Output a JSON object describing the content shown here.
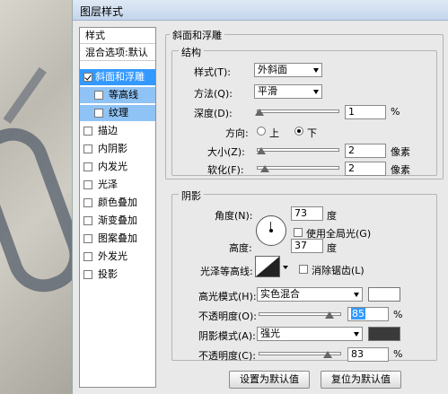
{
  "window_title": "图层样式",
  "left_panel": {
    "header": "样式",
    "blend_options": "混合选项:默认",
    "items": [
      {
        "label": "斜面和浮雕",
        "checked": true
      },
      {
        "label": "等高线",
        "checked": false
      },
      {
        "label": "纹理",
        "checked": false
      },
      {
        "label": "描边",
        "checked": false
      },
      {
        "label": "内阴影",
        "checked": false
      },
      {
        "label": "内发光",
        "checked": false
      },
      {
        "label": "光泽",
        "checked": false
      },
      {
        "label": "颜色叠加",
        "checked": false
      },
      {
        "label": "渐变叠加",
        "checked": false
      },
      {
        "label": "图案叠加",
        "checked": false
      },
      {
        "label": "外发光",
        "checked": false
      },
      {
        "label": "投影",
        "checked": false
      }
    ]
  },
  "bevel": {
    "section_title": "斜面和浮雕",
    "structure_title": "结构",
    "style_label": "样式(T):",
    "style_value": "外斜面",
    "technique_label": "方法(Q):",
    "technique_value": "平滑",
    "depth_label": "深度(D):",
    "depth_value": "1",
    "depth_unit": "%",
    "direction_label": "方向:",
    "dir_up": "上",
    "dir_down": "下",
    "direction_selected": "下",
    "size_label": "大小(Z):",
    "size_value": "2",
    "size_unit": "像素",
    "soften_label": "软化(F):",
    "soften_value": "2",
    "soften_unit": "像素"
  },
  "shading": {
    "section_title": "阴影",
    "angle_label": "角度(N):",
    "angle_value": "73",
    "angle_unit": "度",
    "global_light_label": "使用全局光(G)",
    "global_light_checked": false,
    "altitude_label": "高度:",
    "altitude_value": "37",
    "altitude_unit": "度",
    "gloss_contour_label": "光泽等高线:",
    "antialias_label": "消除锯齿(L)",
    "antialias_checked": false,
    "highlight_mode_label": "高光模式(H):",
    "highlight_mode_value": "实色混合",
    "highlight_color": "#ffffff",
    "highlight_opacity_label": "不透明度(O):",
    "highlight_opacity_value": "85",
    "highlight_opacity_unit": "%",
    "shadow_mode_label": "阴影模式(A):",
    "shadow_mode_value": "强光",
    "shadow_color": "#3a3a3a",
    "shadow_opacity_label": "不透明度(C):",
    "shadow_opacity_value": "83",
    "shadow_opacity_unit": "%"
  },
  "buttons": {
    "make_default": "设置为默认值",
    "reset_default": "复位为默认值"
  },
  "accent": "#3399ff"
}
